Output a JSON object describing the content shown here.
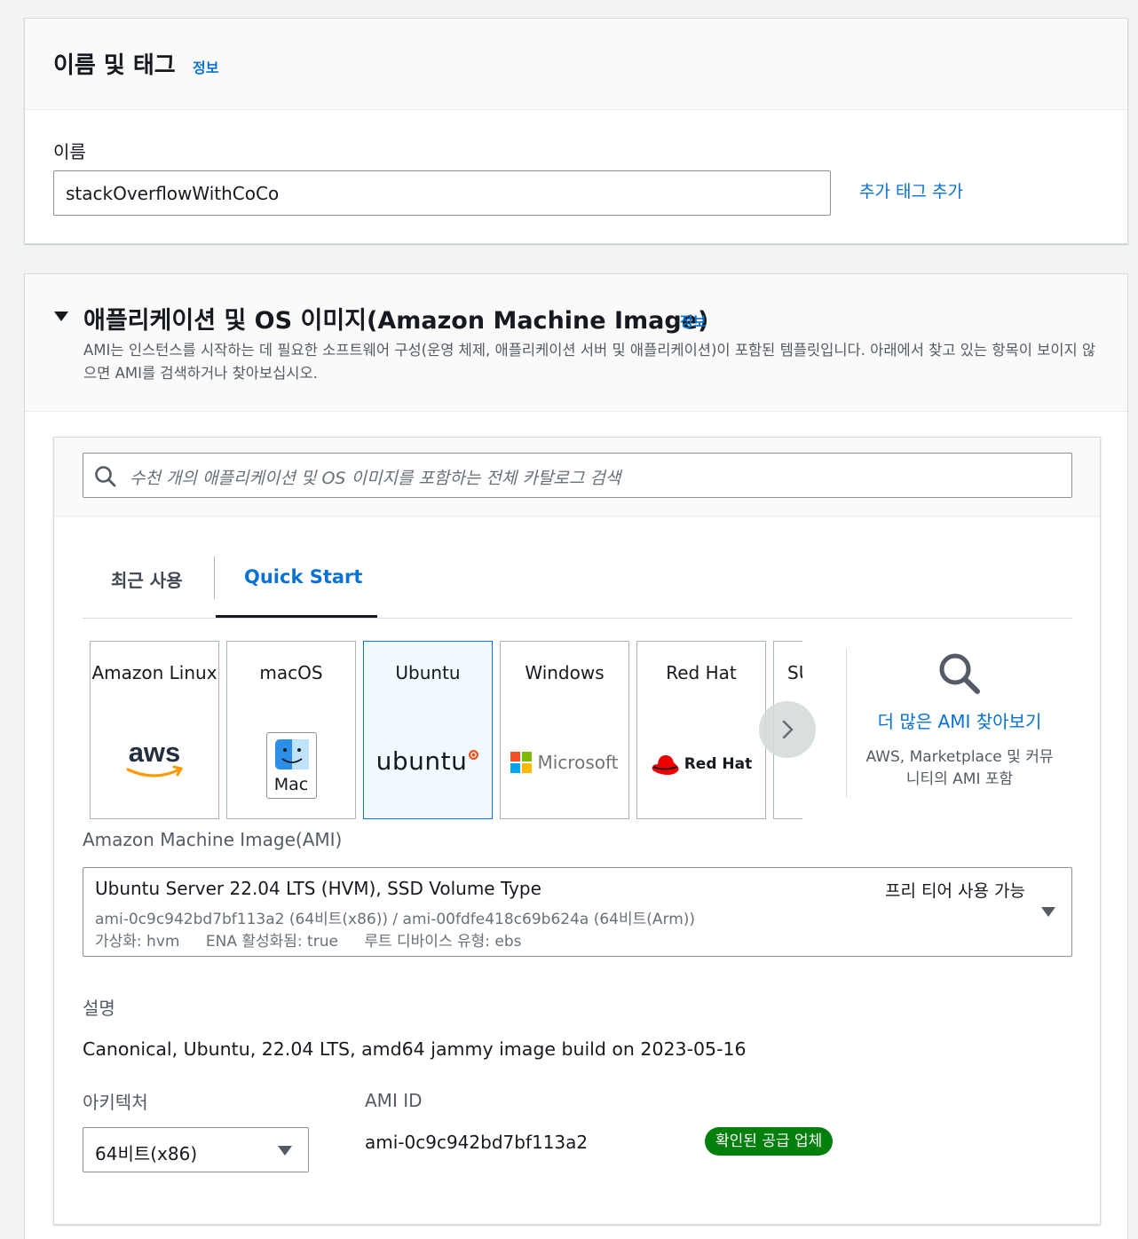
{
  "name_tags": {
    "title": "이름 및 태그",
    "info": "정보",
    "name_label": "이름",
    "name_value": "stackOverflowWithCoCo",
    "add_tag": "추가 태그 추가"
  },
  "ami_section": {
    "title": "애플리케이션 및 OS 이미지(Amazon Machine Image)",
    "info": "정보",
    "description": "AMI는 인스턴스를 시작하는 데 필요한 소프트웨어 구성(운영 체제, 애플리케이션 서버 및 애플리케이션)이 포함된 템플릿입니다. 아래에서 찾고 있는 항목이 보이지 않으면 AMI를 검색하거나 찾아보십시오.",
    "search_placeholder": "수천 개의 애플리케이션 및 OS 이미지를 포함하는 전체 카탈로그 검색",
    "tabs": [
      {
        "label": "최근 사용",
        "active": false
      },
      {
        "label": "Quick Start",
        "active": true
      }
    ],
    "os_tiles": [
      {
        "label": "Amazon Linux",
        "logo_text": "aws",
        "icon": "aws-logo-icon"
      },
      {
        "label": "macOS",
        "logo_text": "Mac",
        "icon": "mac-finder-icon"
      },
      {
        "label": "Ubuntu",
        "logo_text": "ubuntu",
        "icon": "ubuntu-logo-icon",
        "selected": true
      },
      {
        "label": "Windows",
        "logo_text": "Microsoft",
        "icon": "microsoft-logo-icon"
      },
      {
        "label": "Red Hat",
        "logo_text": "Red Hat",
        "icon": "redhat-logo-icon"
      },
      {
        "label": "SUSE Linux",
        "icon": "suse-logo-icon"
      }
    ],
    "browse_more": {
      "label": "더 많은 AMI 찾아보기",
      "sub": "AWS, Marketplace 및 커뮤니티의 AMI 포함"
    },
    "ami_label": "Amazon Machine Image(AMI)",
    "ami_selected": {
      "name": "Ubuntu Server 22.04 LTS (HVM), SSD Volume Type",
      "free_tier": "프리 티어 사용 가능",
      "ids": "ami-0c9c942bd7bf113a2 (64비트(x86)) / ami-00fdfe418c69b624a (64비트(Arm))",
      "virtualization": "가상화: hvm",
      "ena": "ENA 활성화됨: true",
      "root_device": "루트 디바이스 유형: ebs"
    },
    "description_label": "설명",
    "description_value": "Canonical, Ubuntu, 22.04 LTS, amd64 jammy image build on 2023-05-16",
    "arch_label": "아키텍처",
    "arch_value": "64비트(x86)",
    "ami_id_label": "AMI ID",
    "ami_id_value": "ami-0c9c942bd7bf113a2",
    "verified_badge": "확인된 공급 업체"
  },
  "colors": {
    "link": "#0972d3",
    "badge_green": "#037f0c",
    "selected_tile_bg": "#f1faff"
  }
}
